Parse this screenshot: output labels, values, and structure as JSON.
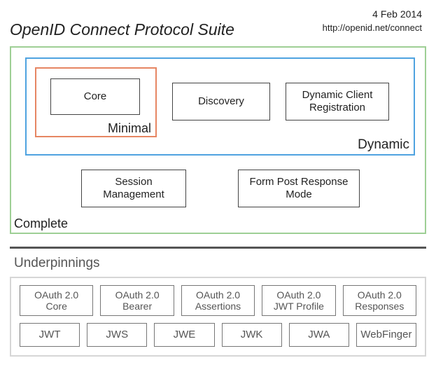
{
  "header": {
    "title": "OpenID Connect Protocol Suite",
    "date": "4 Feb 2014",
    "url": "http://openid.net/connect"
  },
  "labels": {
    "complete": "Complete",
    "dynamic": "Dynamic",
    "minimal": "Minimal"
  },
  "boxes": {
    "core": "Core",
    "discovery": "Discovery",
    "dcr": "Dynamic Client Registration",
    "session": "Session Management",
    "formpost": "Form Post Response Mode"
  },
  "under": {
    "title": "Underpinnings",
    "row1": [
      "OAuth 2.0 Core",
      "OAuth 2.0 Bearer",
      "OAuth 2.0 Assertions",
      "OAuth 2.0 JWT Profile",
      "OAuth 2.0 Responses"
    ],
    "row2": [
      "JWT",
      "JWS",
      "JWE",
      "JWK",
      "JWA",
      "WebFinger"
    ]
  }
}
